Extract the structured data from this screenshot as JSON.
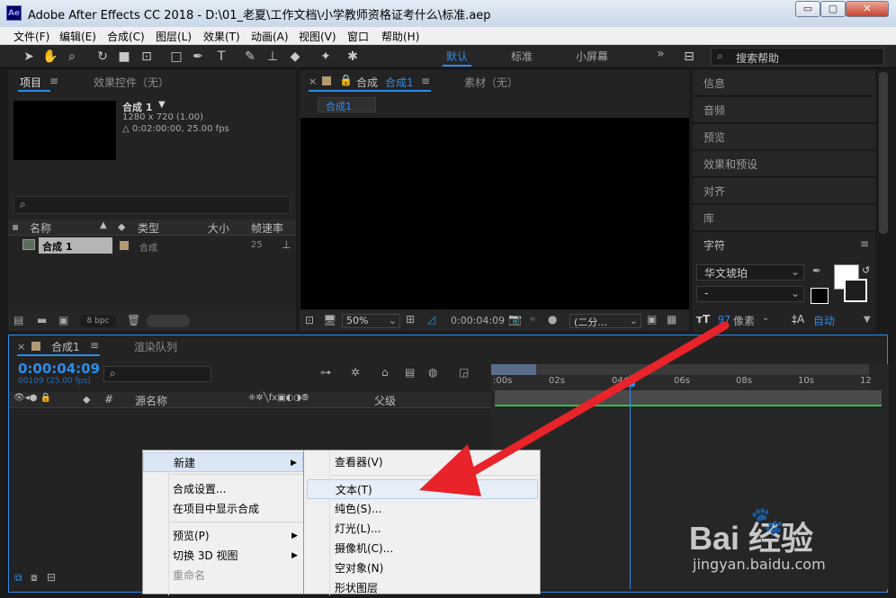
{
  "window": {
    "title": "Adobe After Effects CC 2018 - D:\\01_老夏\\工作文档\\小学教师资格证考什么\\标准.aep",
    "logo": "Ae",
    "min": "▭",
    "max": "▢",
    "close": "✕"
  },
  "menu": [
    "文件(F)",
    "编辑(E)",
    "合成(C)",
    "图层(L)",
    "效果(T)",
    "动画(A)",
    "视图(V)",
    "窗口",
    "帮助(H)"
  ],
  "workspaces": [
    "默认",
    "标准",
    "小屏幕"
  ],
  "search_help": "搜索帮助",
  "project": {
    "tab": "项目",
    "effects_tab": "效果控件（无）",
    "comp_name": "合成 1",
    "comp_info1": "1280 x 720 (1.00)",
    "comp_info2": "△ 0:02:00:00, 25.00 fps",
    "cols": [
      "名称",
      "类型",
      "大小",
      "帧速率"
    ],
    "row": {
      "name": "合成 1",
      "type": "合成",
      "fps": "25"
    },
    "bpc": "8 bpc"
  },
  "viewer": {
    "tab_prefix": "合成",
    "tab_comp": "合成1",
    "footage_tab": "素材（无）",
    "sub_tab": "合成1",
    "zoom": "50%",
    "time": "0:00:04:09",
    "res": "(二分..."
  },
  "right_panels": [
    "信息",
    "音频",
    "预览",
    "效果和预设",
    "对齐",
    "库"
  ],
  "character": {
    "title": "字符",
    "font": "华文琥珀",
    "style": "-",
    "size": "97 像素",
    "leading": "自动",
    "size_val": "97",
    "size_unit": "像素"
  },
  "timeline": {
    "tab": "合成1",
    "render_tab": "渲染队列",
    "timecode": "0:00:04:09",
    "frames": "00109 (25.00 fps)",
    "col_src": "源名称",
    "col_parent": "父级",
    "ticks": [
      ":00s",
      "02s",
      "04s",
      "06s",
      "08s",
      "10s",
      "12"
    ]
  },
  "context_menu": {
    "new": "新建",
    "items": [
      "合成设置...",
      "在项目中显示合成",
      "预览(P)",
      "切换 3D 视图",
      "重命名"
    ]
  },
  "submenu": [
    "查看器(V)",
    "文本(T)",
    "纯色(S)...",
    "灯光(L)...",
    "摄像机(C)...",
    "空对象(N)",
    "形状图层"
  ],
  "watermark": {
    "brand": "Bai  经验",
    "url": "jingyan.baidu.com"
  }
}
